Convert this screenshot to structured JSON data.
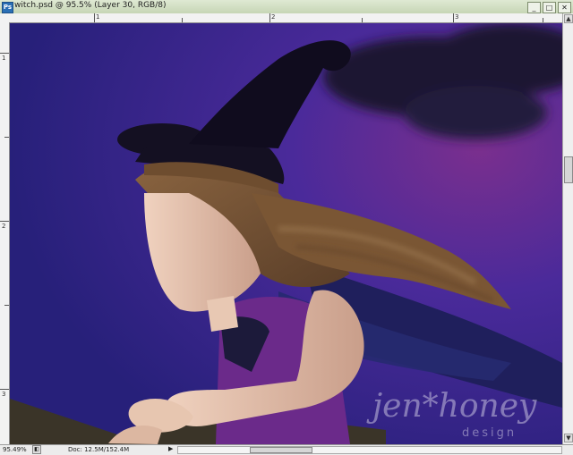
{
  "window": {
    "icon_label": "Ps",
    "title": "witch.psd @ 95.5% (Layer 30, RGB/8)",
    "minimize": "_",
    "maximize": "□",
    "close": "✕"
  },
  "rulers": {
    "top_labels": [
      "1",
      "2",
      "3"
    ],
    "left_labels": [
      "1",
      "2",
      "3"
    ]
  },
  "canvas": {
    "watermark_line1": "jen*honey",
    "watermark_line2": "design",
    "colors": {
      "sky_dark": "#27207a",
      "sky_mid": "#4a2a9a",
      "sky_magenta": "#7a2f8e",
      "hat": "#141022",
      "hair": "#7a5634",
      "skin": "#e6c2ab",
      "dress": "#6b2a8a",
      "broom": "#3a3428"
    }
  },
  "scrollbars": {
    "up_arrow": "▲",
    "down_arrow": "▼"
  },
  "status": {
    "zoom": "95.49%",
    "doc": "Doc: 12.5M/152.4M",
    "arrow": "▶"
  }
}
